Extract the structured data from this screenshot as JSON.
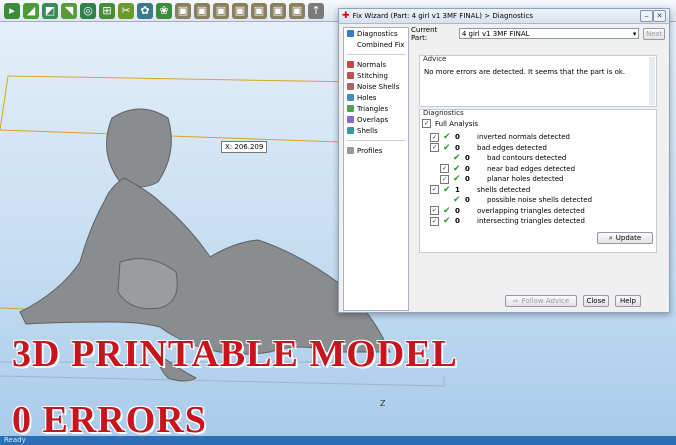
{
  "toolbar": {
    "icons": [
      "pointer-tool",
      "triangle-tool",
      "select-tool",
      "measure-tool",
      "rotate-tool",
      "cut-tool",
      "support-tool",
      "color-tool",
      "shell-tool",
      "view-cube-front",
      "view-cube-back",
      "view-cube-left",
      "view-cube-right",
      "view-cube-top",
      "view-cube-bottom",
      "view-cube-iso",
      "arrow-tool"
    ]
  },
  "viewport": {
    "coord_label": "X: 206.209",
    "overlay_line1": "3D PRINTABLE MODEL",
    "overlay_line2": "0 ERRORS",
    "axis_label": "Z"
  },
  "statusbar": {
    "text": "Ready"
  },
  "dialog": {
    "title": "Fix Wizard (Part: 4 girl v1 3MF FINAL) > Diagnostics",
    "nav": {
      "diagnostics": "Diagnostics",
      "combined_fix": "Combined Fix",
      "normals": "Normals",
      "stitching": "Stitching",
      "noise_shells": "Noise Shells",
      "holes": "Holes",
      "triangles": "Triangles",
      "overlaps": "Overlaps",
      "shells": "Shells",
      "profiles": "Profiles"
    },
    "current_part_label": "Current Part:",
    "current_part_value": "4 girl v1 3MF FINAL",
    "next_label": "Next",
    "advice_title": "Advice",
    "advice_text": "No more errors are detected. It seems that the part is ok.",
    "diagnostics_title": "Diagnostics",
    "full_analysis_label": "Full Analysis",
    "rows": [
      {
        "count": "0",
        "label": "inverted normals detected"
      },
      {
        "count": "0",
        "label": "bad edges detected"
      },
      {
        "count": "0",
        "label": "bad contours detected"
      },
      {
        "count": "0",
        "label": "near bad edges detected"
      },
      {
        "count": "0",
        "label": "planar holes detected"
      },
      {
        "count": "1",
        "label": "shells detected"
      },
      {
        "count": "0",
        "label": "possible noise shells detected"
      },
      {
        "count": "0",
        "label": "overlapping triangles detected"
      },
      {
        "count": "0",
        "label": "intersecting triangles detected"
      }
    ],
    "update_label": "Update",
    "follow_advice_label": "Follow Advice",
    "close_label": "Close",
    "help_label": "Help"
  }
}
